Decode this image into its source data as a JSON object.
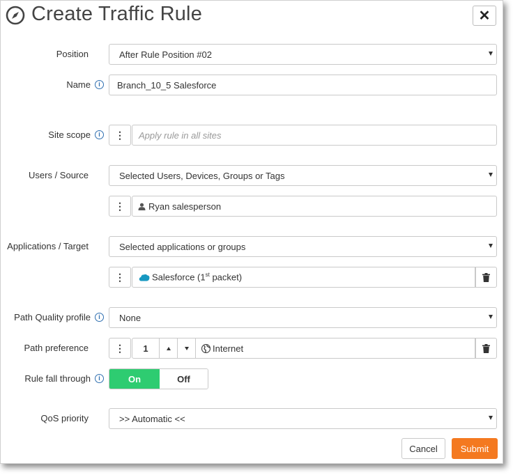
{
  "dialog": {
    "title": "Create Traffic Rule",
    "close_label": "✕"
  },
  "labels": {
    "position": "Position",
    "name": "Name",
    "site_scope": "Site scope",
    "users_source": "Users / Source",
    "applications_target": "Applications / Target",
    "path_quality_profile": "Path Quality profile",
    "path_preference": "Path preference",
    "rule_fall_through": "Rule fall through",
    "qos_priority": "QoS priority"
  },
  "fields": {
    "position_value": "After Rule Position #02",
    "name_value": "Branch_10_5 Salesforce",
    "site_scope_placeholder": "Apply rule in all sites",
    "users_source_value": "Selected Users, Devices, Groups or Tags",
    "user_item": "Ryan salesperson",
    "applications_value": "Selected applications or groups",
    "app_item_prefix": "Salesforce (1",
    "app_item_sup": "st",
    "app_item_suffix": " packet)",
    "path_quality_value": "None",
    "path_pref_number": "1",
    "path_pref_value": "Internet",
    "qos_value": ">> Automatic <<"
  },
  "toggle": {
    "on_label": "On",
    "off_label": "Off"
  },
  "buttons": {
    "cancel": "Cancel",
    "submit": "Submit"
  },
  "colors": {
    "toggle_on": "#2ecc71",
    "submit": "#f47920",
    "info_icon": "#2f6fb0",
    "salesforce_cloud": "#1798c1"
  },
  "icons": {
    "title": "compass-icon",
    "close": "close-icon",
    "info": "info-icon",
    "kebab": "kebab-menu-icon",
    "user": "user-icon",
    "salesforce": "salesforce-cloud-icon",
    "globe": "globe-icon",
    "trash": "trash-icon"
  }
}
